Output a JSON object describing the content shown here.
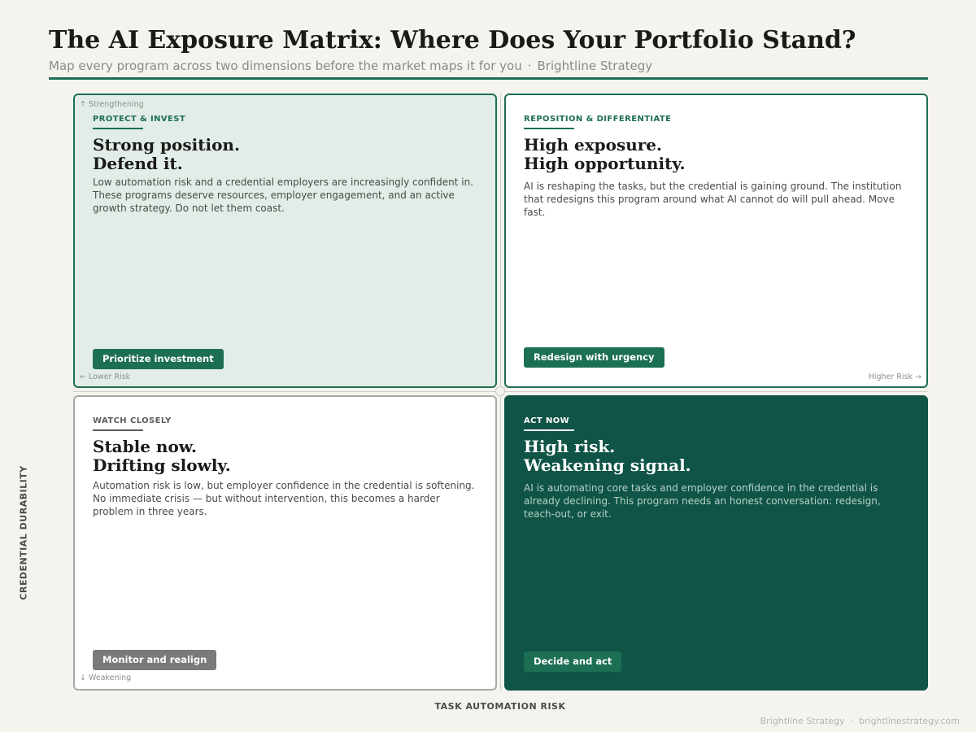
{
  "header": {
    "title": "The AI Exposure Matrix: Where Does Your Portfolio Stand?",
    "subtitle": "Map every program across two dimensions before the market maps it for you",
    "separator": "·",
    "brand": "Brightline Strategy"
  },
  "axes": {
    "y_label": "CREDENTIAL DURABILITY",
    "x_label": "TASK AUTOMATION RISK",
    "top_label": "↑  Strengthening",
    "bottom_label": "↓  Weakening",
    "left_label": "← Lower Risk",
    "right_label": "Higher Risk →"
  },
  "quadrants": {
    "top_left": {
      "tag": "PROTECT & INVEST",
      "headline_line1": "Strong position.",
      "headline_line2": "Defend it.",
      "body": "Low automation risk and a credential employers are increasingly confident in. These programs deserve resources, employer engagement, and an active growth strategy. Do not let them coast.",
      "action": "Prioritize investment"
    },
    "top_right": {
      "tag": "REPOSITION & DIFFERENTIATE",
      "headline_line1": "High exposure.",
      "headline_line2": "High opportunity.",
      "body": "AI is reshaping the tasks, but the credential is gaining ground. The institution that redesigns this program around what AI cannot do will pull ahead. Move fast.",
      "action": "Redesign with urgency"
    },
    "bottom_left": {
      "tag": "WATCH CLOSELY",
      "headline_line1": "Stable now.",
      "headline_line2": "Drifting slowly.",
      "body": "Automation risk is low, but employer confidence in the credential is softening. No immediate crisis — but without intervention, this becomes a harder problem in three years.",
      "action": "Monitor and realign"
    },
    "bottom_right": {
      "tag": "ACT NOW",
      "headline_line1": "High risk.",
      "headline_line2": "Weakening signal.",
      "body": "AI is automating core tasks and employer confidence in the credential is already declining. This program needs an honest conversation: redesign, teach-out, or exit.",
      "action": "Decide and act"
    }
  },
  "footer": {
    "brand": "Brightline Strategy",
    "separator": "·",
    "url": "brightlinestrategy.com"
  },
  "colors": {
    "accent": "#1c6e55",
    "dark_quadrant": "#0f5446",
    "light_quadrant": "#e1ede6",
    "background": "#f4f3ee",
    "neutral_button": "#7a7a78"
  }
}
